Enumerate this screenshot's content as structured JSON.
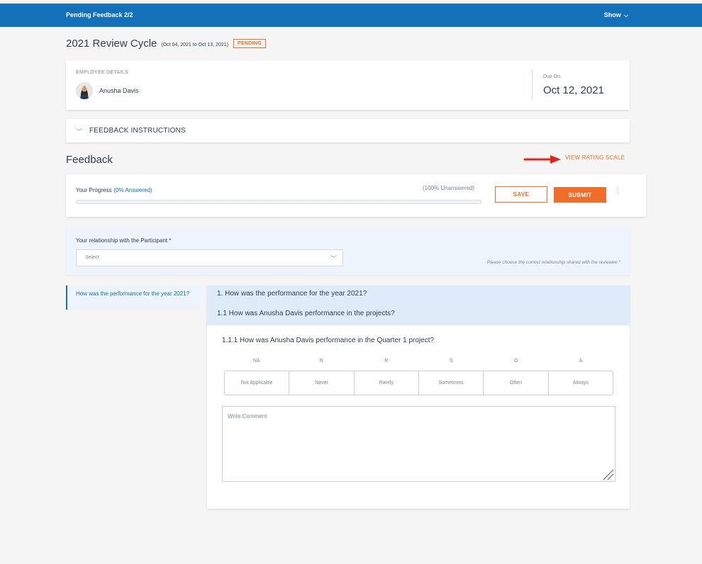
{
  "topbar": {
    "title": "Pending Feedback 2/2",
    "show_label": "Show",
    "brand_color": "#1470b8"
  },
  "cycle": {
    "name": "2021 Review Cycle",
    "dates": "(Oct 04, 2021 to Oct 13, 2021)",
    "status": "PENDING"
  },
  "employee": {
    "section_label": "EMPLOYEE DETAILS",
    "name": "Anusha Davis",
    "due_label": "Due On",
    "due_date": "Oct 12, 2021"
  },
  "instructions": {
    "label": "FEEDBACK INSTRUCTIONS"
  },
  "feedback": {
    "title": "Feedback",
    "rating_link": "VIEW RATING SCALE",
    "accent_color": "#f06e2a"
  },
  "progress": {
    "label": "Your Progress",
    "answered": "(0% Answered)",
    "unanswered": "(100% Unanswered)",
    "fraction": 0,
    "save_label": "SAVE",
    "submit_label": "SUBMIT",
    "menu_glyph": "⋮"
  },
  "relationship": {
    "label": "Your relationship with the Participant *",
    "selected": "Select",
    "hint": "Please choose the correct relationship shared with the reviewee *"
  },
  "sidebar": {
    "items": [
      {
        "label": "How was the performance for the year 2021?"
      }
    ]
  },
  "questions": {
    "q1": "1. How was the performance for the year 2021?",
    "q1_1": "1.1 How was Anusha Davis performance in the projects?",
    "q1_1_1": "1.1.1 How was Anusha Davis performance in the Quarter 1 project?",
    "scale": [
      {
        "code": "NA",
        "label": "Not Applicable"
      },
      {
        "code": "N",
        "label": "Never"
      },
      {
        "code": "R",
        "label": "Rarely"
      },
      {
        "code": "S",
        "label": "Sometimes"
      },
      {
        "code": "O",
        "label": "Often"
      },
      {
        "code": "A",
        "label": "Always"
      }
    ],
    "comment_placeholder": "Write Comment"
  }
}
